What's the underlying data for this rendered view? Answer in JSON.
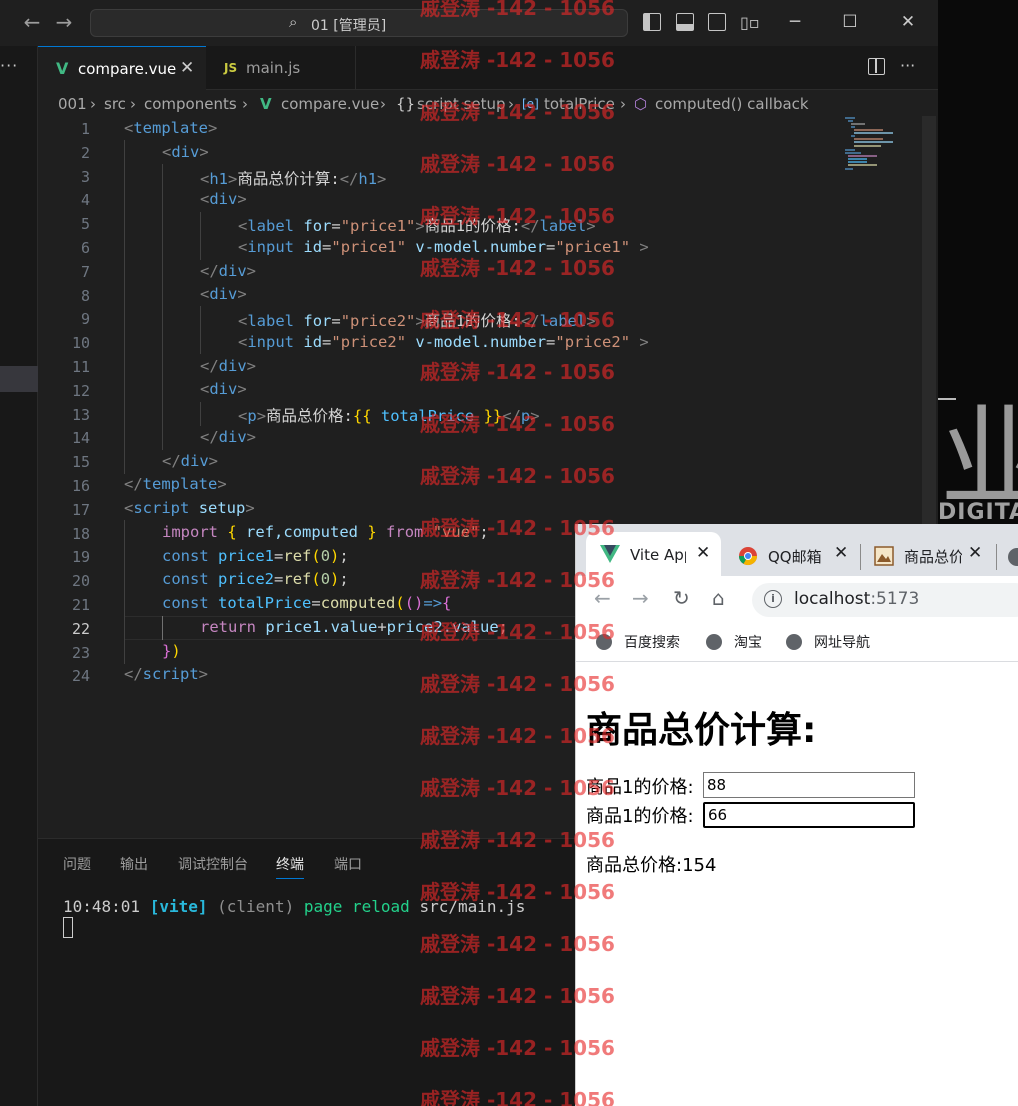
{
  "titlebar": {
    "search_text": "01 [管理员]"
  },
  "tabs": [
    {
      "label": "compare.vue",
      "icon": "V",
      "close": "✕"
    },
    {
      "label": "main.js",
      "icon": "JS"
    }
  ],
  "breadcrumb": [
    "001",
    "src",
    "components",
    "compare.vue",
    "script setup",
    "totalPrice",
    "computed() callback"
  ],
  "breadcrumb_sep": "›",
  "editor": {
    "line_numbers": [
      "1",
      "2",
      "3",
      "4",
      "5",
      "6",
      "7",
      "8",
      "9",
      "10",
      "11",
      "12",
      "13",
      "14",
      "15",
      "16",
      "17",
      "18",
      "19",
      "20",
      "21",
      "22",
      "23",
      "24"
    ],
    "current_line": "22"
  },
  "code_tokens": {
    "template": "template",
    "div": "div",
    "h1": "h1",
    "label": "label",
    "input": "input",
    "p": "p",
    "script": "script",
    "for": "for",
    "id": "id",
    "vmodel": "v-model.number",
    "setup": "setup",
    "price1_str": "\"price1\"",
    "price2_str": "\"price2\"",
    "h1_text": "商品总价计算:",
    "label1_text": "商品1的价格:",
    "label2_text": "商品1的价格:",
    "p_text": "商品总价格:",
    "moustache_open": "{{",
    "moustache_close": "}}",
    "totalPrice": "totalPrice",
    "import": "import",
    "from": "from",
    "vue_str": "\"vue\"",
    "ref_computed": "ref,computed",
    "const": "const",
    "price1": "price1",
    "price2": "price2",
    "ref": "ref",
    "computed": "computed",
    "zero": "0",
    "return": "return",
    "price1_value": "price1.value",
    "plus": "+",
    "price2_value": "price2.value"
  },
  "panel": {
    "tabs": [
      "问题",
      "输出",
      "调试控制台",
      "终端",
      "端口"
    ],
    "active_tab": "终端",
    "terminal": {
      "time": "10:48:01",
      "tag": "[vite]",
      "client": "(client)",
      "msg": "page reload",
      "file": "src/main.js"
    }
  },
  "background": {
    "big_char": "业",
    "small_text": "DIGITA"
  },
  "browser": {
    "tabs": [
      {
        "label": "Vite App",
        "icon": "vite-icon"
      },
      {
        "label": "QQ邮箱",
        "icon": "chrome-icon"
      },
      {
        "label": "商品总价",
        "icon": "image-icon"
      }
    ],
    "close": "✕",
    "url_host": "localhost",
    "url_port": ":5173",
    "info_glyph": "i",
    "bookmarks": [
      "百度搜索",
      "淘宝",
      "网址导航"
    ],
    "page": {
      "heading": "商品总价计算:",
      "label1": "商品1的价格:",
      "label2": "商品1的价格:",
      "value1": "88",
      "value2": "66",
      "total_label": "商品总价格:",
      "total_value": "154"
    }
  },
  "watermark": "戚登涛 -142 - 1056"
}
